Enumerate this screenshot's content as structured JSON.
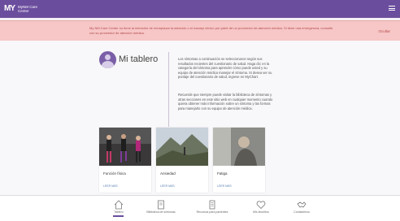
{
  "header": {
    "logo_mark": "MY",
    "app_name_line1": "MyNM Care",
    "app_name_line2": "Center"
  },
  "alert": {
    "text": "My NM Care Center no tiene la intención de reemplazar la atención o el manejo clínico por parte de un proveedor de atención médica. Si tiene una emergencia, consulte con su proveedor de atención médica.",
    "close_label": "Ocultar"
  },
  "main": {
    "title": "Mi tablero",
    "intro": "Los síntomas a continuación se seleccionaron según sus resultados recientes del cuestionario de salud. Haga clic en la categoría del síntoma para aprender cómo puede usted y su equipo de atención médica manejar el síntoma. Si desea ver su puntaje del cuestionario de salud, ingrese en MyChart.",
    "para2": "Recuerde que siempre puede visitar la biblioteca de síntomas y otras secciones en este sitio web en cualquier momento cuando quiera obtener más información sobre un síntoma y las formas para manejarlo con su equipo de atención médica."
  },
  "cards": [
    {
      "title": "Función física",
      "link": "LEER MÁS"
    },
    {
      "title": "Ansiedad",
      "link": "LEER MÁS"
    },
    {
      "title": "Fatiga",
      "link": "LEER MÁS"
    }
  ],
  "nav": [
    {
      "label": "Tablero",
      "icon": "home-icon"
    },
    {
      "label": "Biblioteca de síntomas",
      "icon": "book-icon"
    },
    {
      "label": "Recursos para pacientes",
      "icon": "document-icon"
    },
    {
      "label": "Mis favoritos",
      "icon": "heart-icon"
    },
    {
      "label": "Contáctenos",
      "icon": "handshake-icon"
    }
  ],
  "colors": {
    "brand": "#6b4d9e",
    "alert_bg": "#f7c6c6",
    "alert_text": "#b14a4a"
  }
}
